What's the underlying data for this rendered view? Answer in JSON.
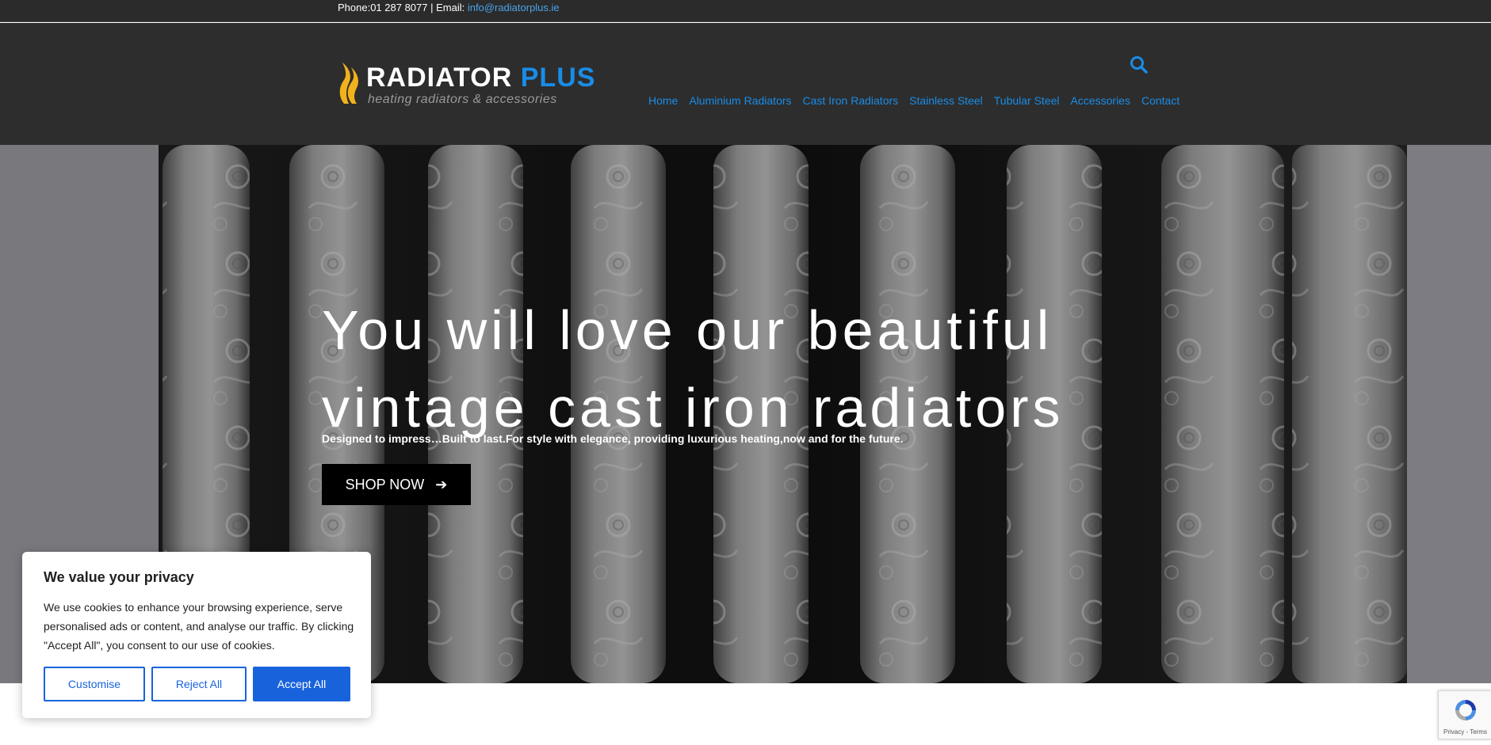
{
  "topbar": {
    "phone_text": "Phone:01 287 8077 | Email: ",
    "email": "info@radiatorplus.ie"
  },
  "header": {
    "logo_word": "RADIATOR",
    "logo_plus": "PLUS",
    "logo_tagline": "heating radiators & accessories",
    "search_icon": "search-icon",
    "nav": [
      {
        "label": "Home"
      },
      {
        "label": "Aluminium Radiators"
      },
      {
        "label": "Cast Iron Radiators"
      },
      {
        "label": "Stainless Steel"
      },
      {
        "label": "Tubular Steel"
      },
      {
        "label": "Accessories"
      },
      {
        "label": "Contact"
      }
    ]
  },
  "hero": {
    "title": "You will love our beautiful vintage cast iron radiators",
    "subtitle": "Designed to impress…Built to last.For style with elegance, providing luxurious heating,now and for the future.",
    "cta_label": "SHOP NOW",
    "cta_icon": "arrow-right-icon"
  },
  "cookie_banner": {
    "title": "We value your privacy",
    "body": "We use cookies to enhance your browsing experience, serve personalised ads or content, and analyse our traffic. By clicking \"Accept All\", you consent to our use of cookies.",
    "customise_label": "Customise",
    "reject_label": "Reject All",
    "accept_label": "Accept All"
  },
  "recaptcha": {
    "footer_text": "Privacy - Terms"
  },
  "colors": {
    "accent_blue": "#1a8ce6",
    "header_bg": "#2d2d2d",
    "cookie_button_blue": "#1863dc",
    "flame_yellow": "#f2b21c"
  }
}
